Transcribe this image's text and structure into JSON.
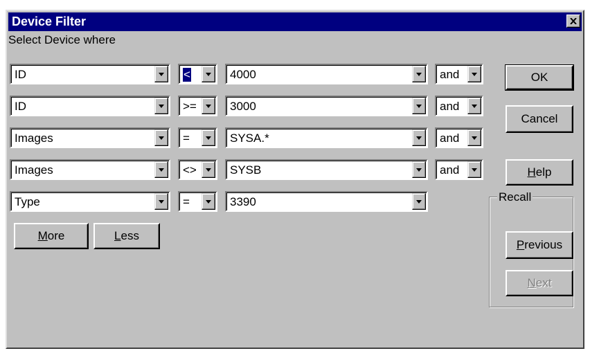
{
  "window": {
    "title": "Device Filter",
    "close_glyph": "×"
  },
  "prompt_label": "Select Device where",
  "rows": [
    {
      "field": "ID",
      "operator": "<",
      "value": "4000",
      "conjunction": "and"
    },
    {
      "field": "ID",
      "operator": ">=",
      "value": "3000",
      "conjunction": "and"
    },
    {
      "field": "Images",
      "operator": "=",
      "value": "SYSA.*",
      "conjunction": "and"
    },
    {
      "field": "Images",
      "operator": "<>",
      "value": "SYSB",
      "conjunction": "and"
    },
    {
      "field": "Type",
      "operator": "=",
      "value": "3390"
    }
  ],
  "buttons": {
    "more": {
      "mnemonic": "M",
      "rest": "ore"
    },
    "less": {
      "mnemonic": "L",
      "rest": "ess"
    },
    "ok": "OK",
    "cancel": "Cancel",
    "help": {
      "mnemonic": "H",
      "rest": "elp"
    }
  },
  "recall": {
    "label": "Recall",
    "previous": {
      "mnemonic": "P",
      "rest": "revious"
    },
    "next": {
      "mnemonic": "N",
      "rest": "ext",
      "disabled": true
    }
  },
  "colors": {
    "face": "#c0c0c0",
    "title_bar": "#000080",
    "selection": "#000080"
  }
}
